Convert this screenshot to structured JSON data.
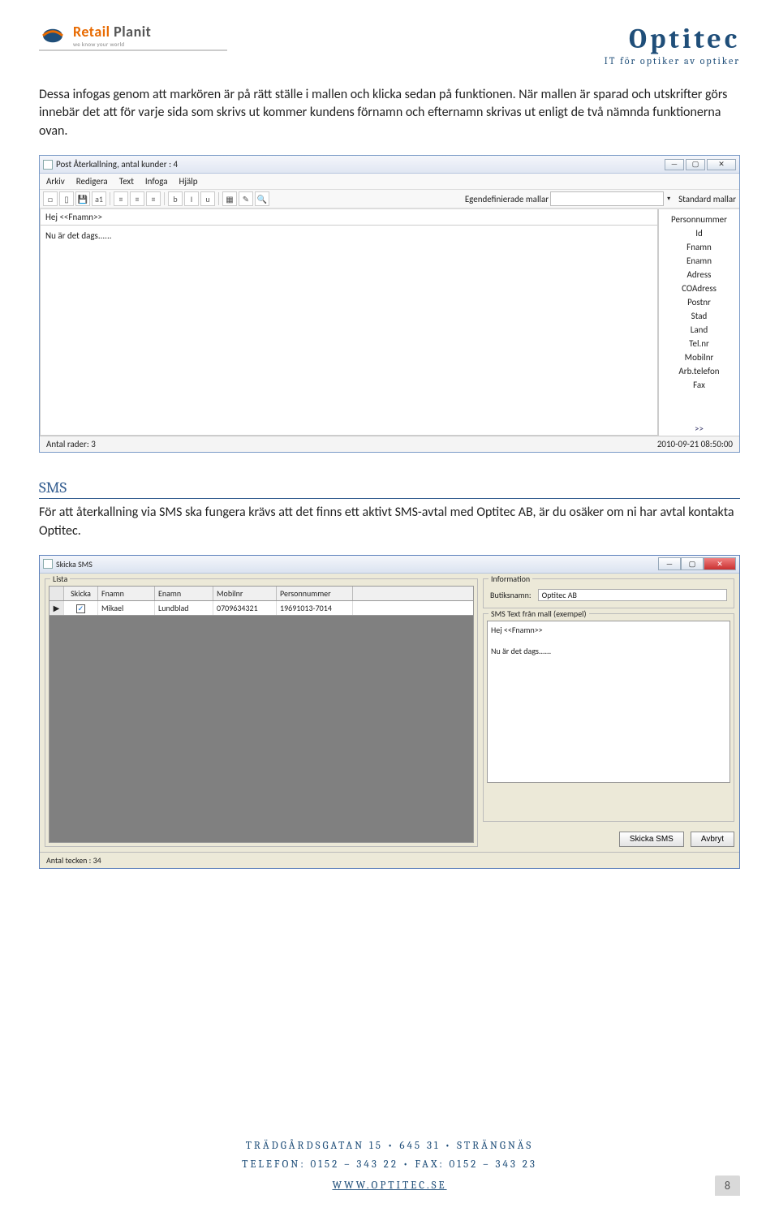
{
  "header": {
    "logo_main1": "Retail",
    "logo_main2": " Planit",
    "logo_sub": "we know your world",
    "brand_title": "Optitec",
    "brand_sub": "IT för optiker av optiker"
  },
  "para1": "Dessa infogas genom att markören är på rätt ställe i mallen och klicka sedan på funktionen. När mallen är sparad och utskrifter görs innebär det att för varje sida som skrivs ut kommer kundens förnamn och efternamn skrivas ut enligt de två nämnda funktionerna ovan.",
  "editor": {
    "title": "Post Återkallning, antal kunder : 4",
    "menu": [
      "Arkiv",
      "Redigera",
      "Text",
      "Infoga",
      "Hjälp"
    ],
    "toolbar_icons": [
      "□",
      "▯",
      "💾",
      "a1",
      "≡",
      "≡",
      "≡",
      "b",
      "I",
      "u",
      "▦",
      "✎",
      "🔍"
    ],
    "label_egen": "Egendefinierade mallar",
    "label_std": "Standard mallar",
    "line1": "Hej <<Fnamn>>",
    "line2": "Nu är det dags......",
    "fields": [
      "Personnummer",
      "Id",
      "Fnamn",
      "Enamn",
      "Adress",
      "COAdress",
      "Postnr",
      "Stad",
      "Land",
      "Tel.nr",
      "Mobilnr",
      "Arb.telefon",
      "Fax"
    ],
    "fields_more": ">>",
    "status_left": "Antal rader: 3",
    "status_right": "2010-09-21 08:50:00"
  },
  "sms_heading": "SMS",
  "sms_para": "För att återkallning via SMS ska fungera krävs att det finns ett aktivt SMS-avtal med Optitec AB, är du osäker om ni har avtal kontakta Optitec.",
  "sms": {
    "title": "Skicka SMS",
    "group_list": "Lista",
    "cols": {
      "skicka": "Skicka",
      "fnamn": "Fnamn",
      "enamn": "Enamn",
      "mobilnr": "Mobilnr",
      "pnr": "Personnummer"
    },
    "row": {
      "sel": "▶",
      "chk": "✓",
      "fnamn": "Mikael",
      "enamn": "Lundblad",
      "mobilnr": "0709634321",
      "pnr": "19691013-7014"
    },
    "group_info": "Information",
    "butik_label": "Butiksnamn:",
    "butik_value": "Optitec AB",
    "group_text": "SMS Text från mall (exempel)",
    "text_body": "Hej <<Fnamn>>\n\nNu är det dags......",
    "btn_send": "Skicka SMS",
    "btn_cancel": "Avbryt",
    "status": "Antal tecken : 34"
  },
  "footer": {
    "addr": "TRÄDGÅRDSGATAN 15 • 645 31 • STRÄNGNÄS",
    "tel": "TELEFON: 0152 – 343 22 • FAX: 0152 – 343 23",
    "url": "WWW.OPTITEC.SE"
  },
  "page_num": "8"
}
